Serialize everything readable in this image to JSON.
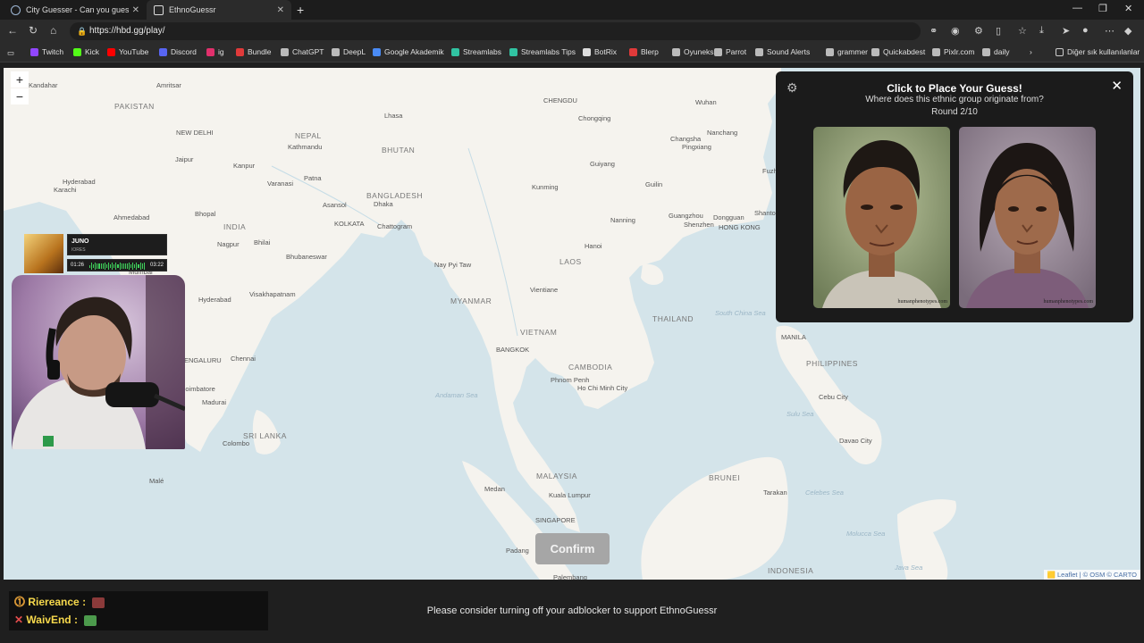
{
  "browser": {
    "tabs": [
      {
        "label": "City Guesser - Can you guess whi",
        "close": "✕"
      },
      {
        "label": "EthnoGuessr",
        "close": "✕"
      }
    ],
    "new_tab": "+",
    "url": "https://hbd.gg/play/",
    "bookmarks": [
      {
        "label": "Twitch",
        "color": "#9146ff"
      },
      {
        "label": "Kick",
        "color": "#53fc18"
      },
      {
        "label": "YouTube",
        "color": "#ff0000"
      },
      {
        "label": "Discord",
        "color": "#5865f2"
      },
      {
        "label": "ig",
        "color": "#e1306c"
      },
      {
        "label": "Bundle",
        "color": "#e03a3a"
      },
      {
        "label": "ChatGPT",
        "color": "#bbbbbb"
      },
      {
        "label": "DeepL",
        "color": "#bbbbbb"
      },
      {
        "label": "Google Akademik",
        "color": "#4a8bf5"
      },
      {
        "label": "Streamlabs",
        "color": "#31c3a2"
      },
      {
        "label": "Streamlabs Tips",
        "color": "#31c3a2"
      },
      {
        "label": "BotRix",
        "color": "#dddddd"
      },
      {
        "label": "Blerp",
        "color": "#e03a3a"
      },
      {
        "label": "Oyuneks",
        "color": "#bbbbbb"
      },
      {
        "label": "Parrot",
        "color": "#bbbbbb"
      },
      {
        "label": "Sound Alerts",
        "color": "#bbbbbb"
      },
      {
        "label": "grammer",
        "color": "#bbbbbb"
      },
      {
        "label": "Quickabdest",
        "color": "#bbbbbb"
      },
      {
        "label": "Pixlr.com",
        "color": "#bbbbbb"
      },
      {
        "label": "daily",
        "color": "#bbbbbb"
      }
    ],
    "other_bookmarks": "Diğer sık kullanılanlar"
  },
  "map": {
    "zoom_in": "+",
    "zoom_out": "−",
    "attribution": "🟨 Leaflet | © OSM © CARTO",
    "countries": [
      "PAKISTAN",
      "NEPAL",
      "BHUTAN",
      "BANGLADESH",
      "INDIA",
      "MYANMAR",
      "LAOS",
      "THAILAND",
      "VIETNAM",
      "CAMBODIA",
      "SRI LANKA",
      "MALAYSIA",
      "BRUNEI",
      "PHILIPPINES",
      "INDONESIA"
    ],
    "cities": [
      "Kandahar",
      "Amritsar",
      "NEW DELHI",
      "Kathmandu",
      "Lhasa",
      "Jaipur",
      "Kanpur",
      "Varanasi",
      "Patna",
      "Hyderabad",
      "Karachi",
      "Ahmedabad",
      "Bhopal",
      "Asansol",
      "Dhaka",
      "KOLKATA",
      "Chattogram",
      "Nagpur",
      "Bhilai",
      "Bhubaneswar",
      "Visakhapatnam",
      "Hyderabad",
      "Chennai",
      "Mumbai",
      "ENGALURU",
      "Coimbatore",
      "Madurai",
      "Colombo",
      "Malé",
      "Nay Pyi Taw",
      "CHENGDU",
      "Chongqing",
      "Wuhan",
      "Changsha",
      "Pingxiang",
      "Nanchang",
      "Guiyang",
      "Kunming",
      "Guilin",
      "Nanning",
      "Guangzhou",
      "Dongguan",
      "Shenzhen",
      "HONG KONG",
      "Hanoi",
      "Vientiane",
      "BANGKOK",
      "Phnom Penh",
      "Ho Chi Minh City",
      "MANILA",
      "Cebu City",
      "Davao City",
      "Kuala Lumpur",
      "Medan",
      "SINGAPORE",
      "Padang",
      "Palembang",
      "Tarakan",
      "Fuzh",
      "Shanto"
    ],
    "seas": [
      "Andaman Sea",
      "South China Sea",
      "Sulu Sea",
      "Celebes Sea",
      "Molucca Sea",
      "Java Sea"
    ],
    "confirm_label": "Confirm"
  },
  "panel": {
    "title": "Click to Place Your Guess!",
    "subtitle": "Where does this ethnic group originate from?",
    "round": "Round 2/10",
    "watermark_left": "humanphenotypes.com",
    "watermark_right": "humanphenotypes.com"
  },
  "overlay": {
    "song": "JUNO",
    "artist": "IORES",
    "time_elapsed": "01:26",
    "time_total": "03:22",
    "progress": 0.43
  },
  "chat": [
    {
      "user": "Riereance :",
      "icon_color": "#f2a93b"
    },
    {
      "user": "WaivEnd :",
      "icon_color": "#e24c4c"
    }
  ],
  "footer": {
    "adblock_note": "Please consider turning off your adblocker to support EthnoGuessr"
  }
}
